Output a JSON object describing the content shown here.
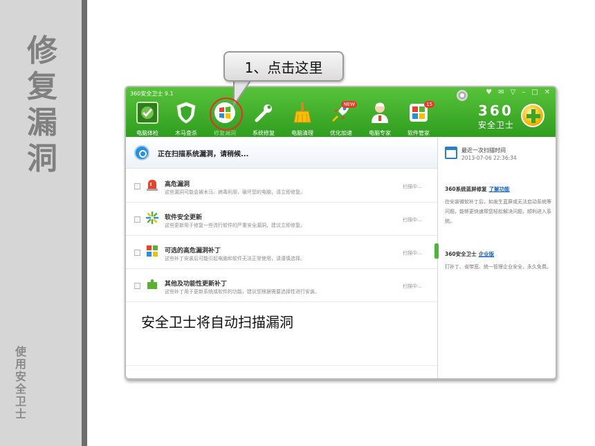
{
  "slide": {
    "title": "修\n复\n漏\n洞",
    "subtitle": "使\n用\n安\n全\n卫\n士"
  },
  "callout": {
    "text": "1、点击这里"
  },
  "window": {
    "title": "360安全卫士 9.1",
    "controls": [
      "♥",
      "✉",
      "▽",
      "–",
      "□",
      "✕"
    ]
  },
  "toolbar": {
    "items": [
      {
        "label": "电脑体检",
        "icon": "pc-checkup-icon"
      },
      {
        "label": "木马查杀",
        "icon": "shield-icon"
      },
      {
        "label": "修复漏洞",
        "icon": "windows-logo-icon",
        "active": true
      },
      {
        "label": "系统修复",
        "icon": "wrench-icon"
      },
      {
        "label": "电脑清理",
        "icon": "broom-icon"
      },
      {
        "label": "优化加速",
        "icon": "rocket-icon",
        "badge": "NEW"
      },
      {
        "label": "电脑专家",
        "icon": "doctor-icon"
      },
      {
        "label": "软件管家",
        "icon": "software-box-icon",
        "badge": "15"
      }
    ]
  },
  "brand": {
    "number": "360",
    "name": "安全卫士"
  },
  "scan": {
    "status": "正在扫描系统漏洞，请稍候..."
  },
  "rows": [
    {
      "title": "高危漏洞",
      "desc": "这些漏洞可能会被木马、病毒利用，破坏您的电脑，请立即修复。",
      "status": "扫描中...",
      "icon": "alarm-icon"
    },
    {
      "title": "软件安全更新",
      "desc": "这些更新用于修复一些流行软件的严重安全漏洞，建议立即修复。",
      "status": "扫描中...",
      "icon": "sparkle-icon"
    },
    {
      "title": "可选的高危漏洞补丁",
      "desc": "这些补丁安装后可能引起电脑和软件无法正常使用，请谨慎选择。",
      "status": "扫描中...",
      "icon": "windows-flag-icon"
    },
    {
      "title": "其他及功能性更新补丁",
      "desc": "这些补丁用于更新系统或软件的功能，建议您根据需要选择性进行安装。",
      "status": "扫描中...",
      "icon": "puzzle-icon"
    }
  ],
  "caption": "安全卫士将自动扫描漏洞",
  "right_panel": {
    "last_scan_label": "最近一次扫描时间",
    "last_scan_time": "2013-07-06 22:36:34",
    "section1_title": "360系统蓝屏修复",
    "section1_link": "了解功能",
    "section1_body": "在安装微软补丁后，如发生蓝屏或无法启动系统等问题，能够更快速帮您轻松解决问题，顺利进入系统。",
    "section2_title": "360安全卫士",
    "section2_link": "企业版",
    "section2_body": "打补丁、省带宽、统一管理企业安全，永久免费。"
  },
  "colors": {
    "header_green": "#3aa82a",
    "highlight_red": "#e3302a",
    "link_blue": "#1a63c2"
  }
}
